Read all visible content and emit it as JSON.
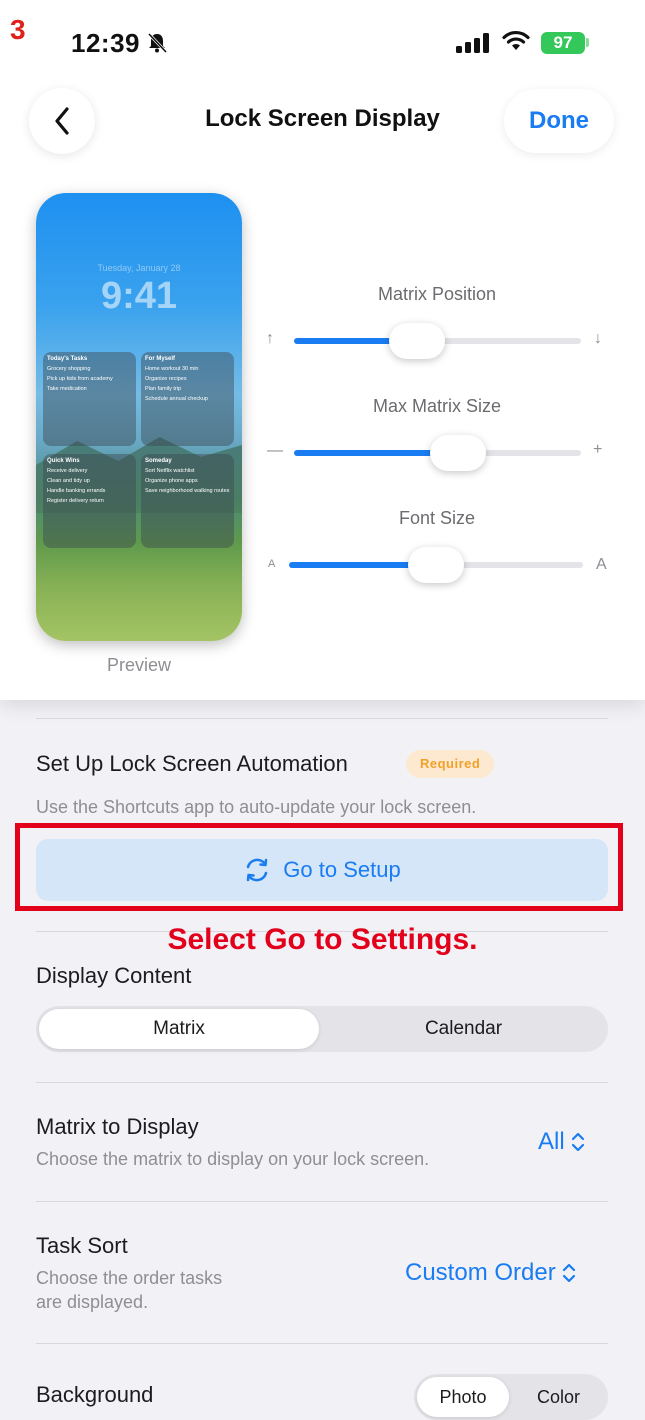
{
  "step_marker": "3",
  "status_bar": {
    "time": "12:39",
    "battery": "97"
  },
  "nav": {
    "title": "Lock Screen Display",
    "done_label": "Done"
  },
  "preview": {
    "label": "Preview",
    "date": "Tuesday, January 28",
    "time": "9:41",
    "quadrants": [
      {
        "title": "Today's Tasks",
        "items": [
          "Grocery shopping",
          "Pick up kids from academy",
          "Take medication"
        ]
      },
      {
        "title": "For Myself",
        "items": [
          "Home workout 30 min",
          "Organize recipes",
          "Plan family trip",
          "Schedule annual checkup"
        ]
      },
      {
        "title": "Quick Wins",
        "items": [
          "Receive delivery",
          "Clean and tidy up",
          "Handle banking errands",
          "Register delivery return"
        ]
      },
      {
        "title": "Someday",
        "items": [
          "Sort Netflix watchlist",
          "Organize phone apps",
          "Save neighborhood walking routes"
        ]
      }
    ]
  },
  "sliders": {
    "matrix_position": {
      "label": "Matrix Position",
      "value": 0.43,
      "min_icon": "↑",
      "max_icon": "↓"
    },
    "max_matrix_size": {
      "label": "Max Matrix Size",
      "value": 0.57,
      "min_icon": "—",
      "max_icon": "+"
    },
    "font_size": {
      "label": "Font Size",
      "value": 0.5,
      "min_icon": "A",
      "max_icon": "A"
    }
  },
  "automation": {
    "title": "Set Up Lock Screen Automation",
    "badge": "Required",
    "description": "Use the Shortcuts app to auto-update your lock screen.",
    "button_label": "Go to Setup"
  },
  "annotation": "Select Go to Settings.",
  "display_content": {
    "title": "Display Content",
    "options": [
      "Matrix",
      "Calendar"
    ],
    "selected": "Matrix"
  },
  "matrix_to_display": {
    "title": "Matrix to Display",
    "description": "Choose the matrix to display on your lock screen.",
    "value": "All"
  },
  "task_sort": {
    "title": "Task Sort",
    "description_line1": "Choose the order tasks",
    "description_line2": "are displayed.",
    "value": "Custom Order"
  },
  "background": {
    "title": "Background",
    "options": [
      "Photo",
      "Color"
    ]
  },
  "colors": {
    "accent": "#1a7cf2",
    "annotation_red": "#e3001b",
    "badge_text": "#f0a12a",
    "battery": "#34c759"
  }
}
